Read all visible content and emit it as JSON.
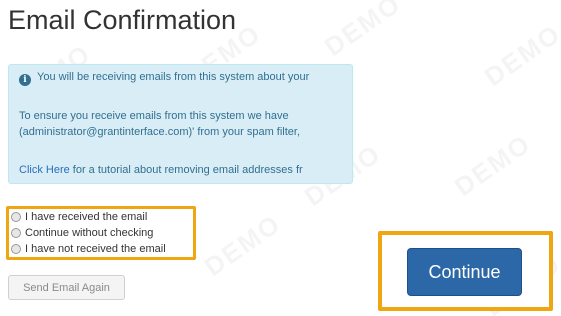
{
  "page": {
    "title": "Email Confirmation"
  },
  "info_box": {
    "icon": "info-circle-icon",
    "line1": "You will be receiving emails from this system about your",
    "line2": "To ensure you receive emails from this system we have",
    "line3": "(administrator@grantinterface.com)' from your spam filter,",
    "link_text": "Click Here",
    "link_suffix": " for a tutorial about removing email addresses fr"
  },
  "radio_options": [
    {
      "label": "I have received the email",
      "selected": false
    },
    {
      "label": "Continue without checking",
      "selected": false
    },
    {
      "label": "I have not received the email",
      "selected": false
    }
  ],
  "buttons": {
    "send_again": "Send Email Again",
    "continue": "Continue"
  },
  "watermark": "DEMO",
  "colors": {
    "highlight": "#f0a513",
    "primary_button": "#2c68a8",
    "info_bg": "#d9edf7",
    "info_text": "#31708f",
    "link": "#2a6ebb"
  }
}
